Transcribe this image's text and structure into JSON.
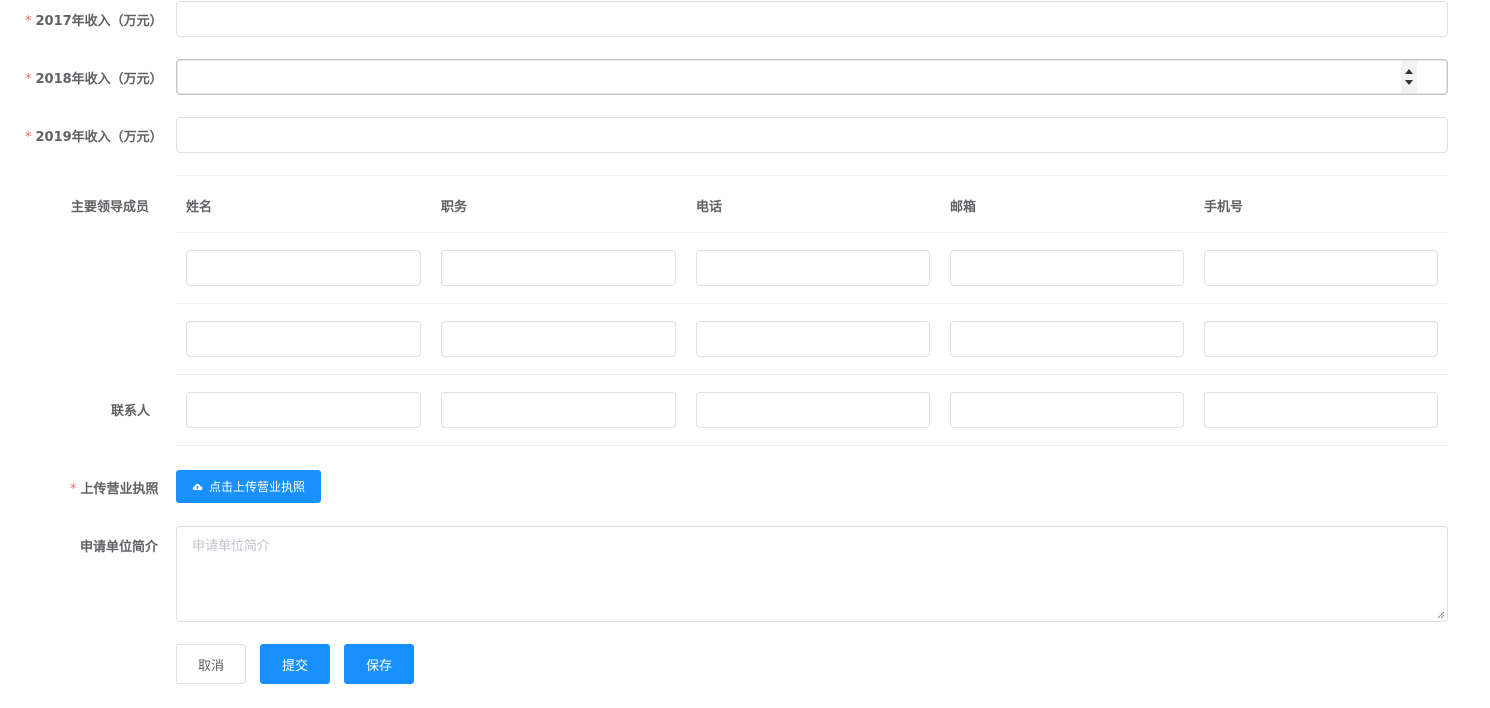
{
  "revenue": {
    "required_mark": "*",
    "y2017_label": "2017年收入（万元）",
    "y2018_label": "2018年收入（万元）",
    "y2019_label": "2019年收入（万元）",
    "y2017_value": "",
    "y2018_value": "",
    "y2019_value": ""
  },
  "leaders": {
    "label": "主要领导成员",
    "columns": [
      "姓名",
      "职务",
      "电话",
      "邮箱",
      "手机号"
    ]
  },
  "contact": {
    "label": "联系人"
  },
  "license": {
    "label": "上传营业执照",
    "upload_button": "点击上传营业执照",
    "upload_icon": "cloud-upload-icon"
  },
  "intro": {
    "label": "申请单位简介",
    "placeholder": "申请单位简介"
  },
  "actions": {
    "cancel": "取消",
    "submit": "提交",
    "save": "保存"
  },
  "colors": {
    "primary": "#1890ff",
    "required": "#f56c6c",
    "border": "#dcdfe6"
  }
}
